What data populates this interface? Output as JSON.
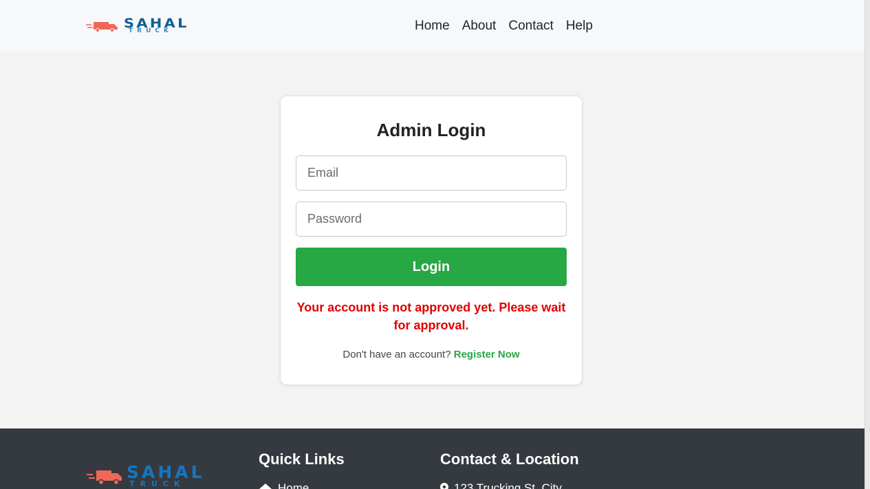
{
  "brand": {
    "name": "SAHAL",
    "sub": "TRUCK",
    "accent": "#0f5f97",
    "truck_color": "#f0675a"
  },
  "nav": {
    "items": [
      "Home",
      "About",
      "Contact",
      "Help"
    ]
  },
  "login": {
    "title": "Admin Login",
    "email_placeholder": "Email",
    "password_placeholder": "Password",
    "button_label": "Login",
    "button_color": "#28a745",
    "error": "Your account is not approved yet. Please wait for approval.",
    "error_color": "#e00000",
    "register_prompt": "Don't have an account?",
    "register_link": "Register Now"
  },
  "footer": {
    "quick_links_heading": "Quick Links",
    "contact_heading": "Contact & Location",
    "home_link": "Home",
    "address": "123 Trucking St, City"
  }
}
